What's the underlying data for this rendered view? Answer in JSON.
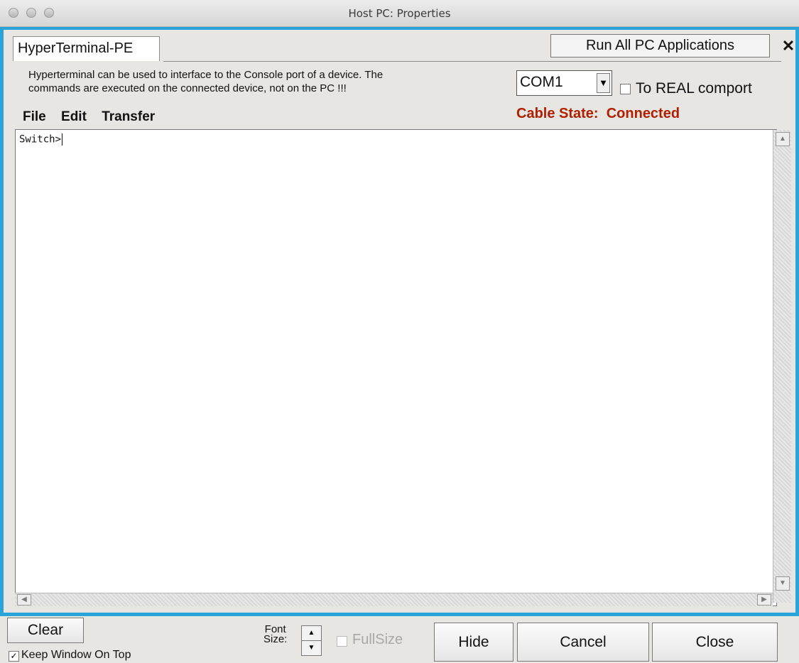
{
  "window": {
    "title": "Host PC: Properties"
  },
  "tabs": [
    {
      "label": "HyperTerminal-PE"
    }
  ],
  "toolbar": {
    "run_all_label": "Run All PC Applications",
    "close_x": "✕"
  },
  "description": {
    "line1": "Hyperterminal can be used to interface to the Console port of a device.  The",
    "line2": "commands are executed on the connected device, not on the PC !!!"
  },
  "port": {
    "selected": "COM1",
    "real_comport_label": "To REAL comport",
    "real_comport_checked": false
  },
  "menu": {
    "items": [
      "File",
      "Edit",
      "Transfer"
    ]
  },
  "cable_state": {
    "label": "Cable State:",
    "value": "Connected"
  },
  "terminal": {
    "content": "Switch>"
  },
  "footer": {
    "clear_label": "Clear",
    "keep_on_top_label": "Keep Window On Top",
    "keep_on_top_checked": true,
    "font_label_1": "Font",
    "font_label_2": "Size:",
    "fullsize_label": "FullSize",
    "fullsize_checked": false,
    "hide_label": "Hide",
    "cancel_label": "Cancel",
    "close_label": "Close"
  },
  "colors": {
    "frame_accent": "#2aa3d8",
    "cable_state": "#b01f00"
  }
}
